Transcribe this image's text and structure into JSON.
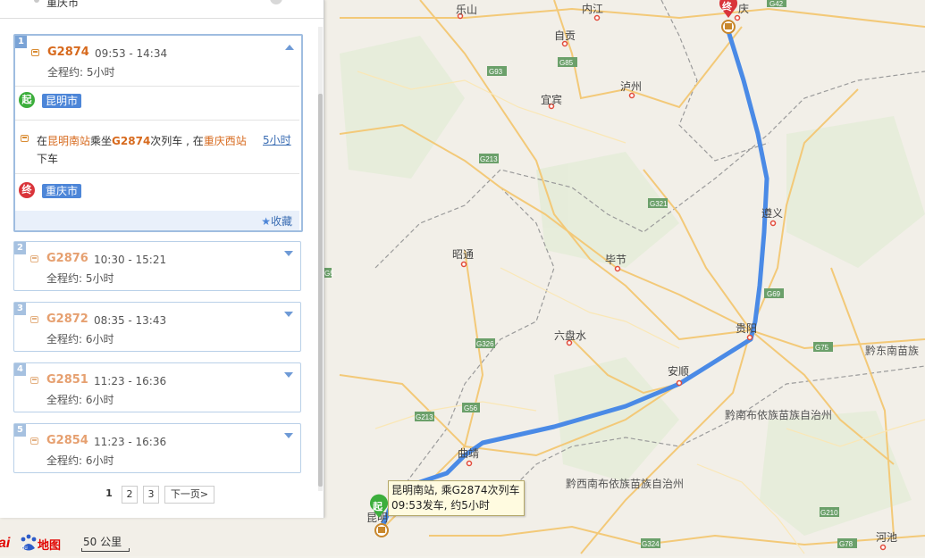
{
  "map": {
    "cities": [
      {
        "name": "乐山"
      },
      {
        "name": "内江"
      },
      {
        "name": "庆"
      },
      {
        "name": "自贡"
      },
      {
        "name": "泸州"
      },
      {
        "name": "宜宾"
      },
      {
        "name": "遵义"
      },
      {
        "name": "昭通"
      },
      {
        "name": "毕节"
      },
      {
        "name": "贵阳"
      },
      {
        "name": "六盘水"
      },
      {
        "name": "安顺"
      },
      {
        "name": "曲靖"
      },
      {
        "name": "昆明"
      },
      {
        "name": "河池"
      }
    ],
    "regions": [
      {
        "name": "黔东南苗族"
      },
      {
        "name": "黔南布依族苗族自治州"
      },
      {
        "name": "黔西南布依族苗族自治州"
      }
    ],
    "highways": [
      "G42",
      "G93",
      "G85",
      "G213",
      "G321",
      "G69",
      "G326",
      "G75",
      "G56",
      "G213",
      "G324",
      "G78",
      "G210",
      "G5"
    ]
  },
  "panel": {
    "top_text": "重庆市",
    "routes": [
      {
        "index": "1",
        "train": "G2874",
        "time": "09:53 - 14:34",
        "duration": "全程约: 5小时"
      },
      {
        "index": "2",
        "train": "G2876",
        "time": "10:30 - 15:21",
        "duration": "全程约: 5小时"
      },
      {
        "index": "3",
        "train": "G2872",
        "time": "08:35 - 13:43",
        "duration": "全程约: 6小时"
      },
      {
        "index": "4",
        "train": "G2851",
        "time": "11:23 - 16:36",
        "duration": "全程约: 6小时"
      },
      {
        "index": "5",
        "train": "G2854",
        "time": "11:23 - 16:36",
        "duration": "全程约: 6小时"
      }
    ],
    "detail": {
      "start_badge": "起",
      "start_city": "昆明市",
      "step_prefix": "在",
      "board_station": "昆明南站",
      "take": "乘坐",
      "train": "G2874",
      "train_suffix": "次列车 , 在",
      "alight_station": "重庆西站",
      "alight_suffix": "下车",
      "step_duration": "5小时",
      "end_badge": "终",
      "end_city": "重庆市",
      "collect": "收藏"
    },
    "pager": {
      "current": "1",
      "p2": "2",
      "p3": "3",
      "next": "下一页>"
    }
  },
  "tooltip": {
    "line1": "昆明南站, 乘G2874次列车",
    "line2": "09:53发车, 约5小时"
  },
  "start_marker": "起",
  "end_marker": "终",
  "logo": {
    "text": "地图"
  },
  "scale": {
    "label": "50 公里"
  },
  "colors": {
    "route": "#4a8ae6",
    "accent": "#d76a1e",
    "start": "#3cae3c",
    "end": "#d9343a"
  }
}
